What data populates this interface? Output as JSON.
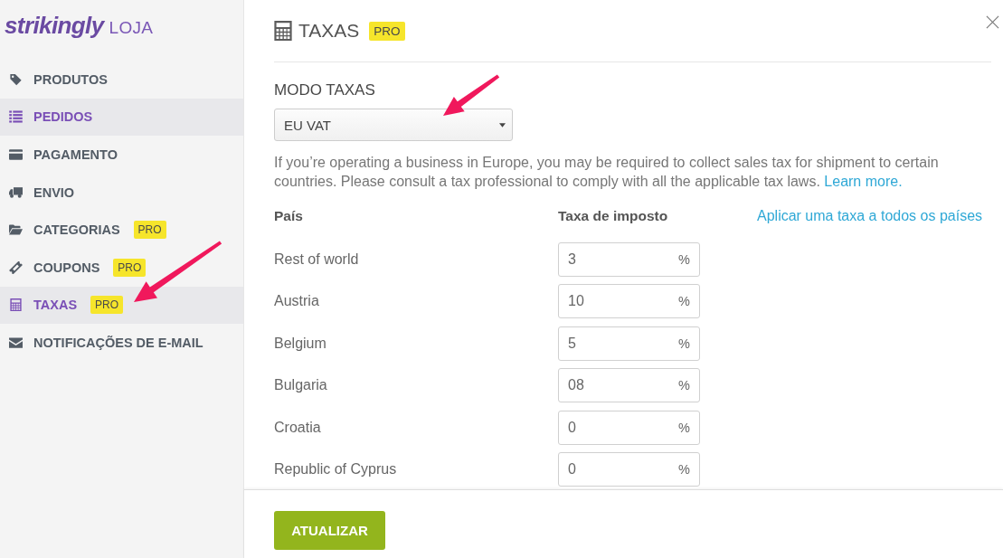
{
  "sidebar": {
    "logo": {
      "wordmark": "strikingly",
      "section": "LOJA"
    },
    "items": [
      {
        "label": "PRODUTOS",
        "selected": false,
        "arrow_callout": false
      },
      {
        "label": "PEDIDOS",
        "selected": true,
        "arrow_callout": false
      },
      {
        "label": "PAGAMENTO",
        "selected": false,
        "arrow_callout": false
      },
      {
        "label": "ENVIO",
        "selected": false,
        "arrow_callout": false
      },
      {
        "label": "CATEGORIAS",
        "badge": "PRO",
        "selected": false,
        "arrow_callout": false
      },
      {
        "label": "COUPONS",
        "badge": "PRO",
        "selected": false,
        "arrow_callout": false
      },
      {
        "label": "TAXAS",
        "badge": "PRO",
        "selected": true,
        "arrow_callout": true
      },
      {
        "label": "NOTIFICAÇÕES DE E-MAIL",
        "selected": false,
        "arrow_callout": false
      }
    ]
  },
  "panel": {
    "title": "TAXAS",
    "badge": "PRO",
    "tax_mode": {
      "label": "MODO TAXAS",
      "value": "EU VAT",
      "arrow_callout": true
    },
    "description": {
      "text": "If you’re operating a business in Europe, you may be required to collect sales tax for shipment to certain countries. Please consult a tax professional to comply with all the applicable tax laws.",
      "link": "Learn more."
    },
    "table": {
      "columns": [
        "País",
        "Taxa de imposto"
      ],
      "apply_all_link": "Aplicar uma taxa a todos os países",
      "rows": [
        {
          "country": "Rest of world",
          "rate": "3",
          "unit": "%"
        },
        {
          "country": "Austria",
          "rate": "10",
          "unit": "%"
        },
        {
          "country": "Belgium",
          "rate": "5",
          "unit": "%"
        },
        {
          "country": "Bulgaria",
          "rate": "08",
          "unit": "%"
        },
        {
          "country": "Croatia",
          "rate": "0",
          "unit": "%"
        },
        {
          "country": "Republic of Cyprus",
          "rate": "0",
          "unit": "%"
        }
      ]
    },
    "footer": {
      "button": "ATUALIZAR"
    }
  }
}
